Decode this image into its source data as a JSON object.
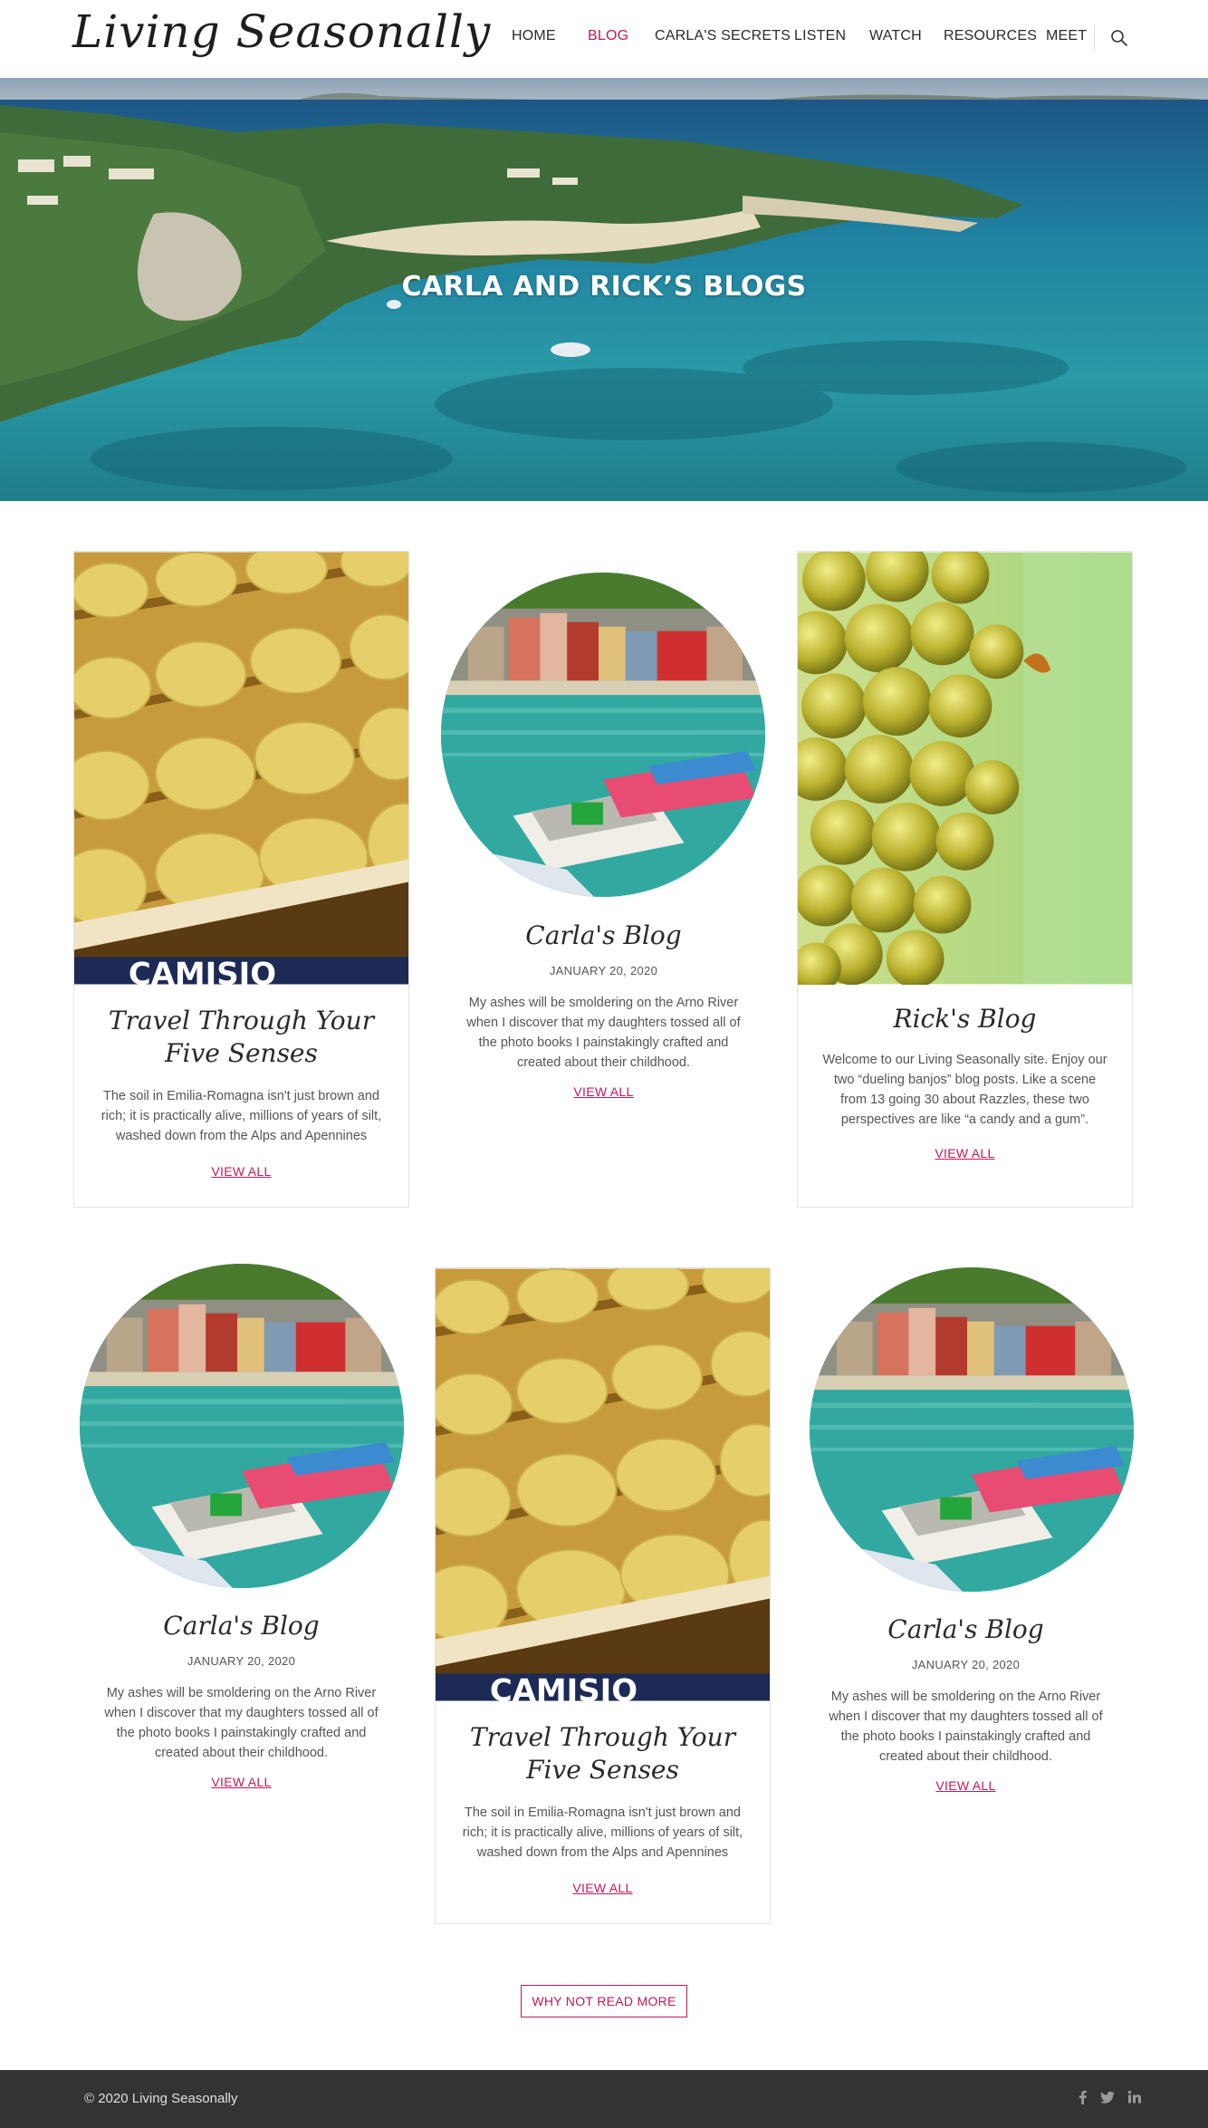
{
  "header": {
    "logo": "Living Seasonally",
    "nav": [
      {
        "label": "HOME",
        "active": false
      },
      {
        "label": "BLOG",
        "active": true
      },
      {
        "label": "CARLA'S SECRETS",
        "active": false
      },
      {
        "label": "LISTEN",
        "active": false
      },
      {
        "label": "WATCH",
        "active": false
      },
      {
        "label": "RESOURCES",
        "active": false
      },
      {
        "label": "MEET",
        "active": false
      }
    ],
    "search_icon": "search-icon"
  },
  "hero": {
    "title": "CARLA AND RICK’S BLOGS"
  },
  "cards": {
    "travel_1": {
      "title_line1": "Travel Through Your",
      "title_line2": "Five Senses",
      "text": "The soil in Emilia-Romagna isn't just brown and rich; it is practically alive, millions of years of silt, washed down from the  Alps and Apennines",
      "link": "VIEW ALL"
    },
    "carla_1": {
      "title": "Carla's Blog",
      "date": "JANUARY 20, 2020",
      "text": "My ashes will be smoldering on the Arno River when I discover that my daughters tossed all of the photo books I painstakingly crafted and created about their childhood.",
      "link": "VIEW ALL"
    },
    "rick_1": {
      "title": "Rick's Blog",
      "text": "Welcome to our Living Seasonally site. Enjoy our two “dueling banjos” blog posts. Like a scene from 13 going 30 about Razzles, these two perspectives are like “a candy and a gum”.",
      "link": "VIEW ALL"
    },
    "carla_2": {
      "title": "Carla's Blog",
      "date": "JANUARY 20, 2020",
      "text": "My ashes will be smoldering on the Arno River when I discover that my daughters tossed all of the photo books I painstakingly crafted and created about their childhood.",
      "link": "VIEW ALL"
    },
    "travel_2": {
      "title_line1": "Travel Through Your",
      "title_line2": "Five Senses",
      "text": "The soil in Emilia-Romagna isn't just brown and rich; it is practically alive, millions of years of silt, washed down from the  Alps and Apennines",
      "link": "VIEW ALL"
    },
    "carla_3": {
      "title": "Carla's Blog",
      "date": "JANUARY 20, 2020",
      "text": "My ashes will be smoldering on the Arno River when I discover that my daughters tossed all of the photo books I painstakingly crafted and created about their childhood.",
      "link": "VIEW ALL"
    }
  },
  "read_more": "WHY NOT READ MORE",
  "footer": {
    "copyright": "© 2020 Living Seasonally",
    "social": [
      "facebook-icon",
      "twitter-icon",
      "linkedin-icon"
    ]
  },
  "colors": {
    "accent": "#c2185b",
    "footer_bg": "#333333",
    "text": "#555555"
  }
}
